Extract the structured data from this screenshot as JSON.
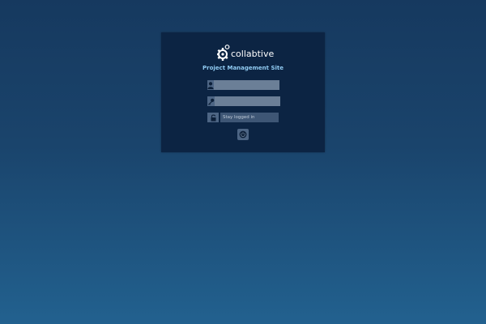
{
  "brand": {
    "name": "collabtive",
    "subtitle": "Project Management Site"
  },
  "login": {
    "username_value": "",
    "password_value": "",
    "stay_logged_in_label": "Stay logged in"
  },
  "icons": {
    "logo": "gear-logo-icon",
    "username": "user-icon",
    "password": "key-icon",
    "stay_logged_in": "lock-icon",
    "submit": "power-icon"
  },
  "colors": {
    "panel": "#0c2443",
    "accent": "#8fc9f0",
    "background_top": "#16395f",
    "background_bottom": "#22618f"
  }
}
